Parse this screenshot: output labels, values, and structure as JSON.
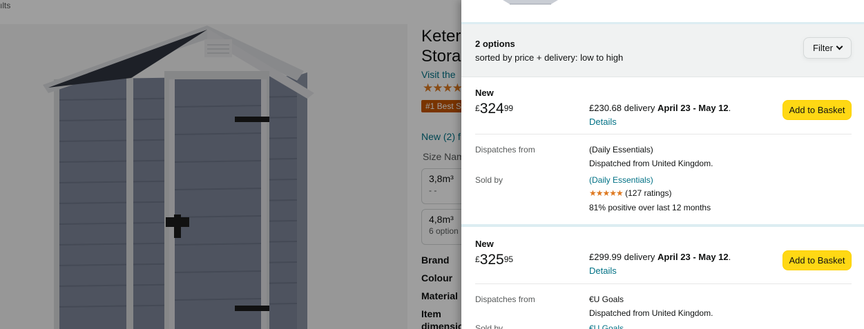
{
  "background": {
    "breadcrumb": "ılts",
    "title_line1": "Keter",
    "title_line2": "Stora",
    "visit_link": "Visit the",
    "rating_stars": "★★★★",
    "bestseller_badge": "#1 Best Se",
    "new_offers": "New (2) f",
    "size_label": "Size Nam",
    "sizes": [
      {
        "value": "3,8m³",
        "sub": "- -"
      },
      {
        "value": "4,8m³",
        "sub": "6 option"
      }
    ],
    "specs": [
      "Brand",
      "Colour",
      "Material",
      "Item",
      "dimension"
    ]
  },
  "panel": {
    "count": "2 options",
    "sort": "sorted by price + delivery: low to high",
    "filter_label": "Filter",
    "offers": [
      {
        "condition": "New",
        "currency": "£",
        "price_whole": "324",
        "price_frac": "99",
        "delivery_price": "£230.68 delivery",
        "delivery_dates": "April 23 - May 12",
        "details_link": "Details",
        "add_label": "Add to Basket",
        "dispatch_label": "Dispatches from",
        "dispatch_value": "(Daily Essentials)",
        "dispatch_note": "Dispatched from United Kingdom.",
        "sold_label": "Sold by",
        "seller": "(Daily Essentials)",
        "seller_stars": "★★★★★",
        "ratings": "(127 ratings)",
        "positive": "81% positive over last 12 months"
      },
      {
        "condition": "New",
        "currency": "£",
        "price_whole": "325",
        "price_frac": "95",
        "delivery_price": "£299.99 delivery",
        "delivery_dates": "April 23 - May 12",
        "details_link": "Details",
        "add_label": "Add to Basket",
        "dispatch_label": "Dispatches from",
        "dispatch_value": "€U Goals",
        "dispatch_note": "Dispatched from United Kingdom.",
        "sold_label": "Sold by",
        "seller": "€U Goals"
      }
    ]
  },
  "colors": {
    "link": "#007185",
    "add_button": "#ffd814",
    "star": "#de7921",
    "badge": "#c45500"
  }
}
